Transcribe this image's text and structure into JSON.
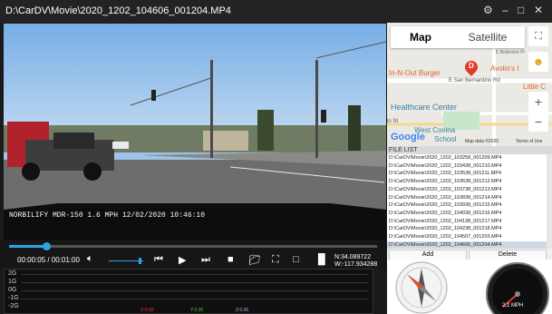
{
  "window": {
    "title": "D:\\CarDV\\Movie\\2020_1202_104606_001204.MP4"
  },
  "video": {
    "osd_text": "NORBILIFY MDR-150  1.6 MPH 12/02/2020 10:46:10"
  },
  "player": {
    "progress": 0.1,
    "time_text": "00:00:05 / 00:01:00",
    "volume": 0.9,
    "coords": {
      "lat": "N:34.089722",
      "lon": "W:-117.934288"
    }
  },
  "graph": {
    "y_labels": [
      "2G",
      "1G",
      "0G",
      "-1G",
      "-2G"
    ],
    "legend_x": "X:0.00",
    "legend_y": "Y:0.00",
    "legend_z": "Z:0.00"
  },
  "map": {
    "tab_map": "Map",
    "tab_satellite": "Satellite",
    "labels": {
      "street1": "E Bellerrine Pl",
      "burger": "In-N-Out Burger",
      "avolio": "Avolio's I",
      "street2": "E San Bernardino Rd",
      "little": "Little C",
      "health": "Healthcare Center",
      "school1": "West Covina",
      "school2": "School",
      "street3": "N Sunkist Ave",
      "ct": "lo St",
      "google": "Google",
      "mapdata": "Map data ©2020",
      "terms": "Terms of Use"
    },
    "marker_letter": "D"
  },
  "file_list": {
    "header": "FILE LIST",
    "files": [
      "D:\\CarDV\\Movie\\2020_1202_103258_001209.MP4",
      "D:\\CarDV\\Movie\\2020_1202_103438_001210.MP4",
      "D:\\CarDV\\Movie\\2020_1202_103538_001211.MP4",
      "D:\\CarDV\\Movie\\2020_1202_103638_001212.MP4",
      "D:\\CarDV\\Movie\\2020_1202_103738_001213.MP4",
      "D:\\CarDV\\Movie\\2020_1202_103838_001214.MP4",
      "D:\\CarDV\\Movie\\2020_1202_103938_001215.MP4",
      "D:\\CarDV\\Movie\\2020_1202_104038_001216.MP4",
      "D:\\CarDV\\Movie\\2020_1202_104138_001217.MP4",
      "D:\\CarDV\\Movie\\2020_1202_104238_001218.MP4",
      "D:\\CarDV\\Movie\\2020_1202_104507_001203.MP4",
      "D:\\CarDV\\Movie\\2020_1202_104606_001204.MP4"
    ],
    "selected_index": 11,
    "add_label": "Add",
    "delete_label": "Delete"
  },
  "speedometer": {
    "speed_text": "2.2 MPH",
    "scale": [
      "0",
      "20",
      "40",
      "60",
      "80",
      "100",
      "120",
      "140",
      "160",
      "180",
      "200",
      "220"
    ]
  },
  "colors": {
    "accent": "#2aa6e0",
    "map_marker": "#e63a2e"
  }
}
